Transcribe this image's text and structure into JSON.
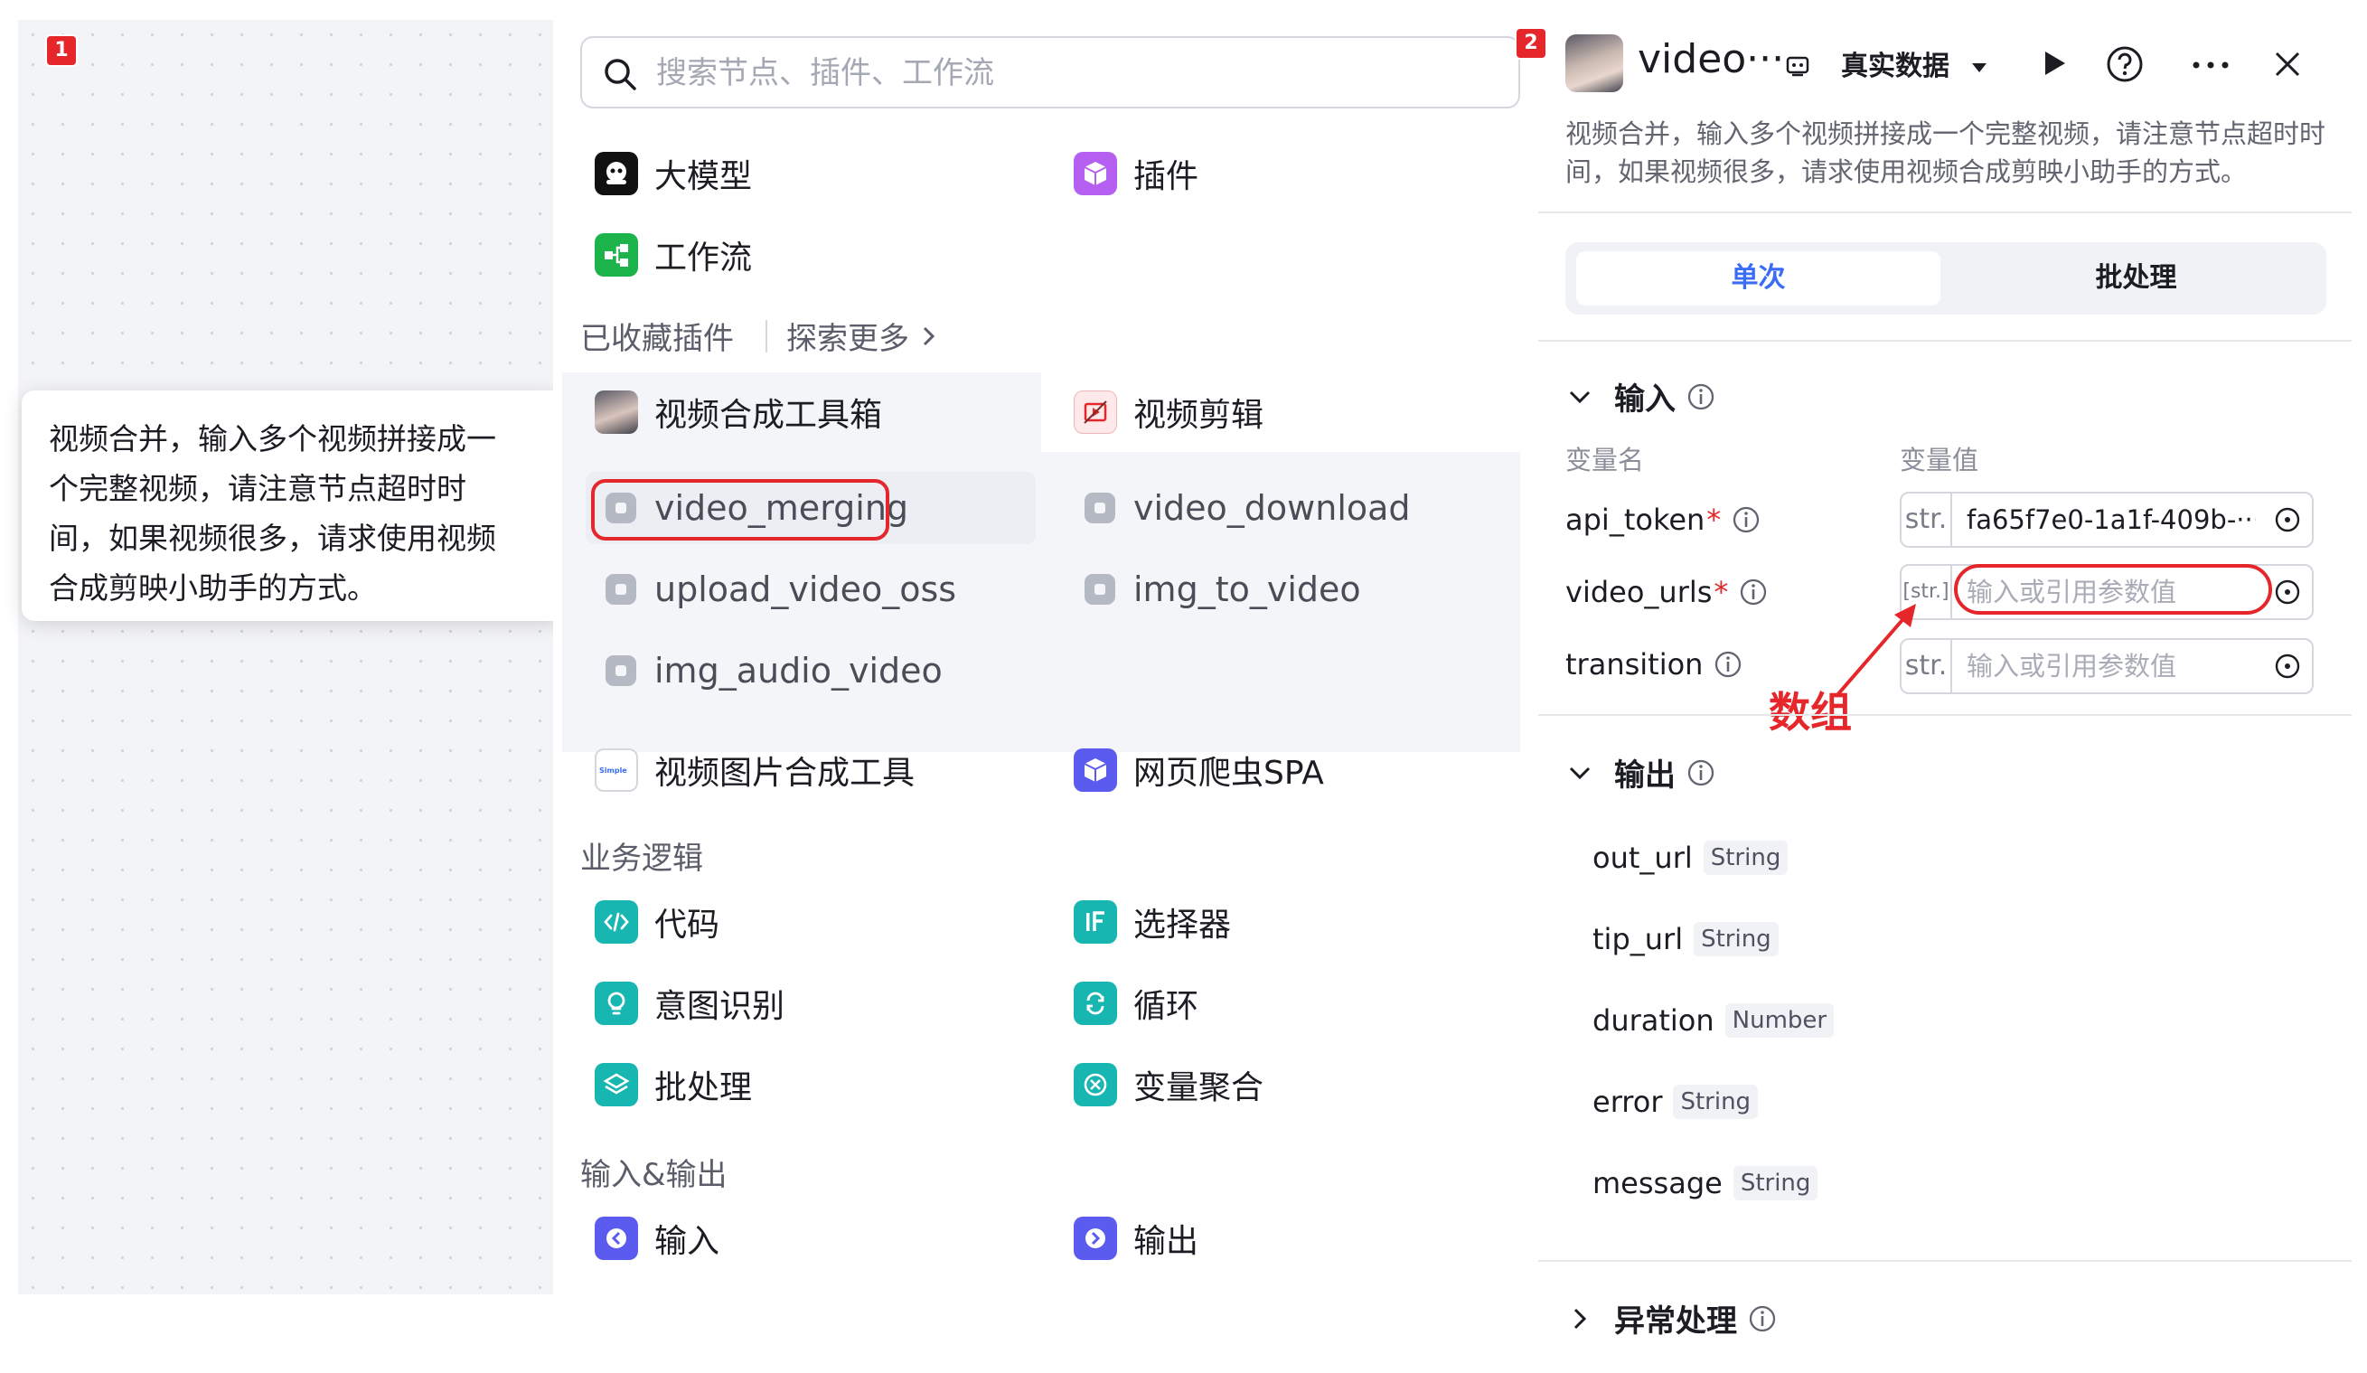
{
  "canvas": {
    "badge": "1",
    "tooltip_lines": [
      "视频合并，输入多个视频拼接成一",
      "个完整视频，请注意节点超时时",
      "间，如果视频很多，请求使用视频",
      "合成剪映小助手的方式。"
    ]
  },
  "node_panel": {
    "search_placeholder": "搜索节点、插件、工作流",
    "top_items": [
      {
        "label": "大模型",
        "icon": "llm-icon",
        "color": "#111111"
      },
      {
        "label": "插件",
        "icon": "plugin-cube-icon",
        "color": "#b55ff0"
      },
      {
        "label": "工作流",
        "icon": "workflow-icon",
        "color": "#1cb34b"
      }
    ],
    "favorites_title": "已收藏插件",
    "explore_more": "探索更多",
    "plugin_tabs": [
      {
        "label": "视频合成工具箱",
        "icon": "video-toolbox-avatar-icon"
      },
      {
        "label": "视频剪辑",
        "icon": "video-edit-icon"
      }
    ],
    "tools": [
      "video_merging",
      "video_download",
      "upload_video_oss",
      "img_to_video",
      "img_audio_video"
    ],
    "more_plugins": [
      {
        "label": "视频图片合成工具",
        "icon": "simple-logo-icon"
      },
      {
        "label": "网页爬虫SPA",
        "icon": "plugin-cube-icon",
        "color": "#5b5bf0"
      }
    ],
    "business_title": "业务逻辑",
    "business_items": [
      {
        "label": "代码",
        "icon": "code-icon",
        "color": "#18b6b0"
      },
      {
        "label": "选择器",
        "icon": "if-icon",
        "color": "#18b6b0"
      },
      {
        "label": "意图识别",
        "icon": "lightbulb-icon",
        "color": "#18b6b0"
      },
      {
        "label": "循环",
        "icon": "loop-icon",
        "color": "#18b6b0"
      },
      {
        "label": "批处理",
        "icon": "layers-icon",
        "color": "#18b6b0"
      },
      {
        "label": "变量聚合",
        "icon": "aggregate-icon",
        "color": "#18b6b0"
      }
    ],
    "io_title": "输入&输出",
    "io_items": [
      {
        "label": "输入",
        "icon": "input-icon",
        "color": "#5b5bf0"
      },
      {
        "label": "输出",
        "icon": "output-icon",
        "color": "#5b5bf0"
      }
    ]
  },
  "config_panel": {
    "badge": "2",
    "title": "video···",
    "real_data": "真实数据",
    "description": "视频合并，输入多个视频拼接成一个完整视频，请注意节点超时时间，如果视频很多，请求使用视频合成剪映小助手的方式。",
    "mode_single": "单次",
    "mode_batch": "批处理",
    "input_title": "输入",
    "col_name": "变量名",
    "col_value": "变量值",
    "inputs": [
      {
        "name": "api_token",
        "required": "*",
        "type": "str.",
        "value": "fa65f7e0-1a1f-409b-···",
        "placeholder": ""
      },
      {
        "name": "video_urls",
        "required": "*",
        "type": "[str.]",
        "value": "",
        "placeholder": "输入或引用参数值"
      },
      {
        "name": "transition",
        "required": "",
        "type": "str.",
        "value": "",
        "placeholder": "输入或引用参数值"
      }
    ],
    "array_annotation": "数组",
    "output_title": "输出",
    "outputs": [
      {
        "name": "out_url",
        "type": "String"
      },
      {
        "name": "tip_url",
        "type": "String"
      },
      {
        "name": "duration",
        "type": "Number"
      },
      {
        "name": "error",
        "type": "String"
      },
      {
        "name": "message",
        "type": "String"
      }
    ],
    "exception_title": "异常处理"
  },
  "colors": {
    "accent": "#3b6cf6",
    "annotation_red": "#e5262b",
    "teal": "#18b6b0"
  }
}
